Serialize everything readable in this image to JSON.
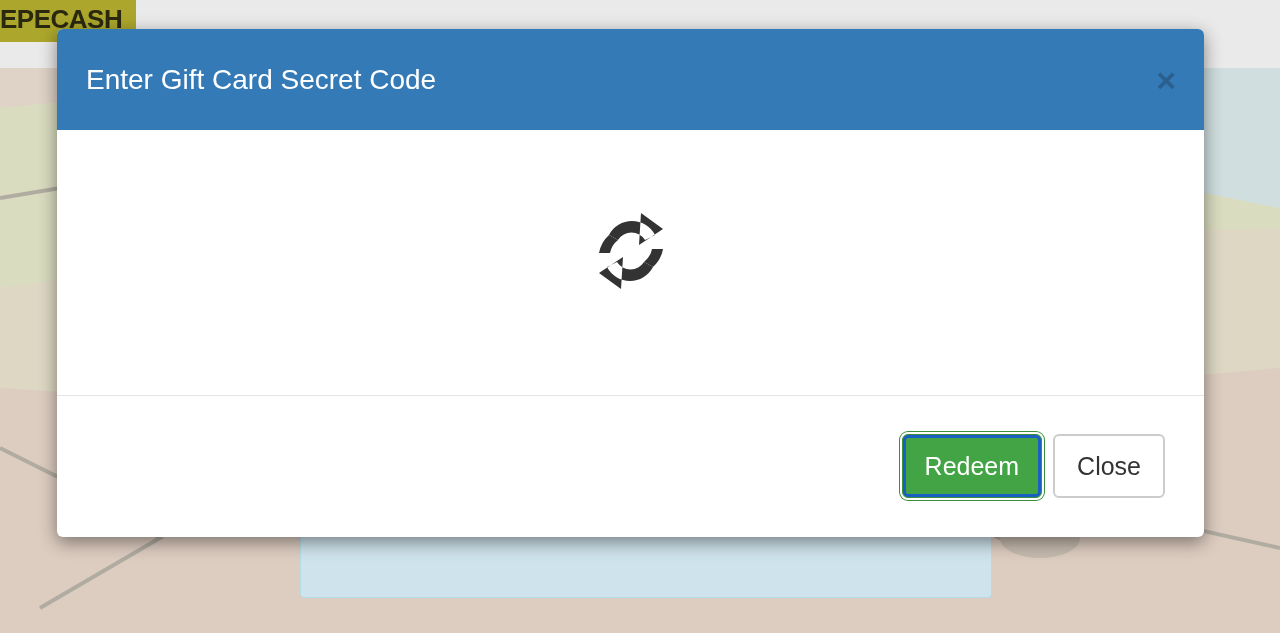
{
  "site": {
    "logo": "EPECASH"
  },
  "modal": {
    "title": "Enter Gift Card Secret Code",
    "close": "×",
    "loading": true,
    "buttons": [
      {
        "label": "Redeem",
        "kind": "primary",
        "focused": true
      },
      {
        "label": "Close",
        "kind": "default",
        "focused": false
      }
    ]
  }
}
